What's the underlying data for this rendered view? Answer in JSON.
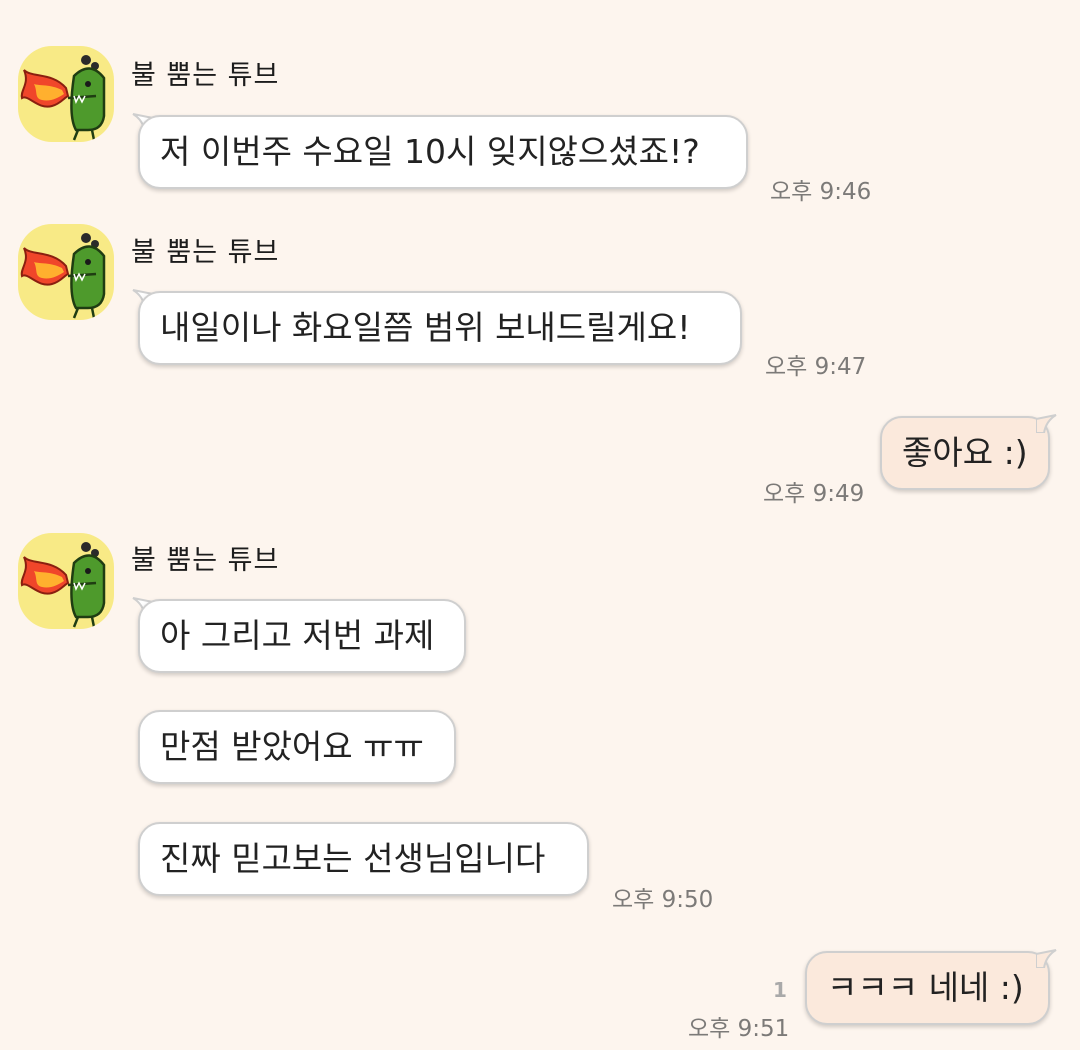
{
  "chat": {
    "sender_name": "불 뿜는 튜브",
    "messages": [
      {
        "text": "저 이번주 수요일 10시 잊지않으셨죠!?",
        "time": "오후 9:46"
      },
      {
        "text": "내일이나 화요일쯤 범위 보내드릴게요!",
        "time": "오후 9:47"
      },
      {
        "text": "좋아요 :)",
        "time": "오후 9:49"
      },
      {
        "text": "아 그리고 저번 과제"
      },
      {
        "text": "만점 받았어요 ㅠㅠ"
      },
      {
        "text": "진짜 믿고보는 선생님입니다",
        "time": "오후 9:50"
      },
      {
        "text": "ㅋㅋㅋ 네네 :)",
        "time": "오후 9:51",
        "unread_count": "1"
      }
    ]
  },
  "avatar_icon": "fire-breathing-tube-character-icon",
  "colors": {
    "background": "#fdf5ee",
    "incoming_bubble": "#ffffff",
    "outgoing_bubble": "#fbe9dc",
    "avatar_bg": "#f8ea86"
  }
}
